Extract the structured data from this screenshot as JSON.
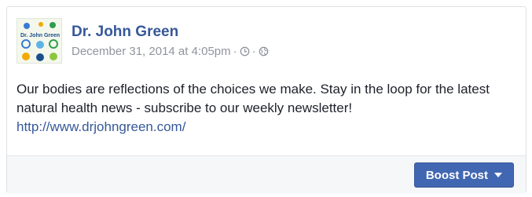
{
  "post": {
    "author": "Dr. John Green",
    "avatar_label": "Dr. John Green",
    "timestamp": "December 31, 2014 at 4:05pm",
    "separator1": "·",
    "separator2": "·",
    "clock_icon": "clock-icon",
    "privacy_icon": "globe-icon",
    "body_line": "Our bodies are reflections of the choices we make. Stay in the loop for the latest natural health news - subscribe to our weekly newsletter!",
    "link": "http://www.drjohngreen.com/"
  },
  "footer": {
    "boost_label": "Boost Post",
    "boost_icon": "caret-down-icon"
  },
  "colors": {
    "link": "#365899",
    "button": "#4267b2",
    "meta_text": "#90949c",
    "body_text": "#1d2129"
  }
}
